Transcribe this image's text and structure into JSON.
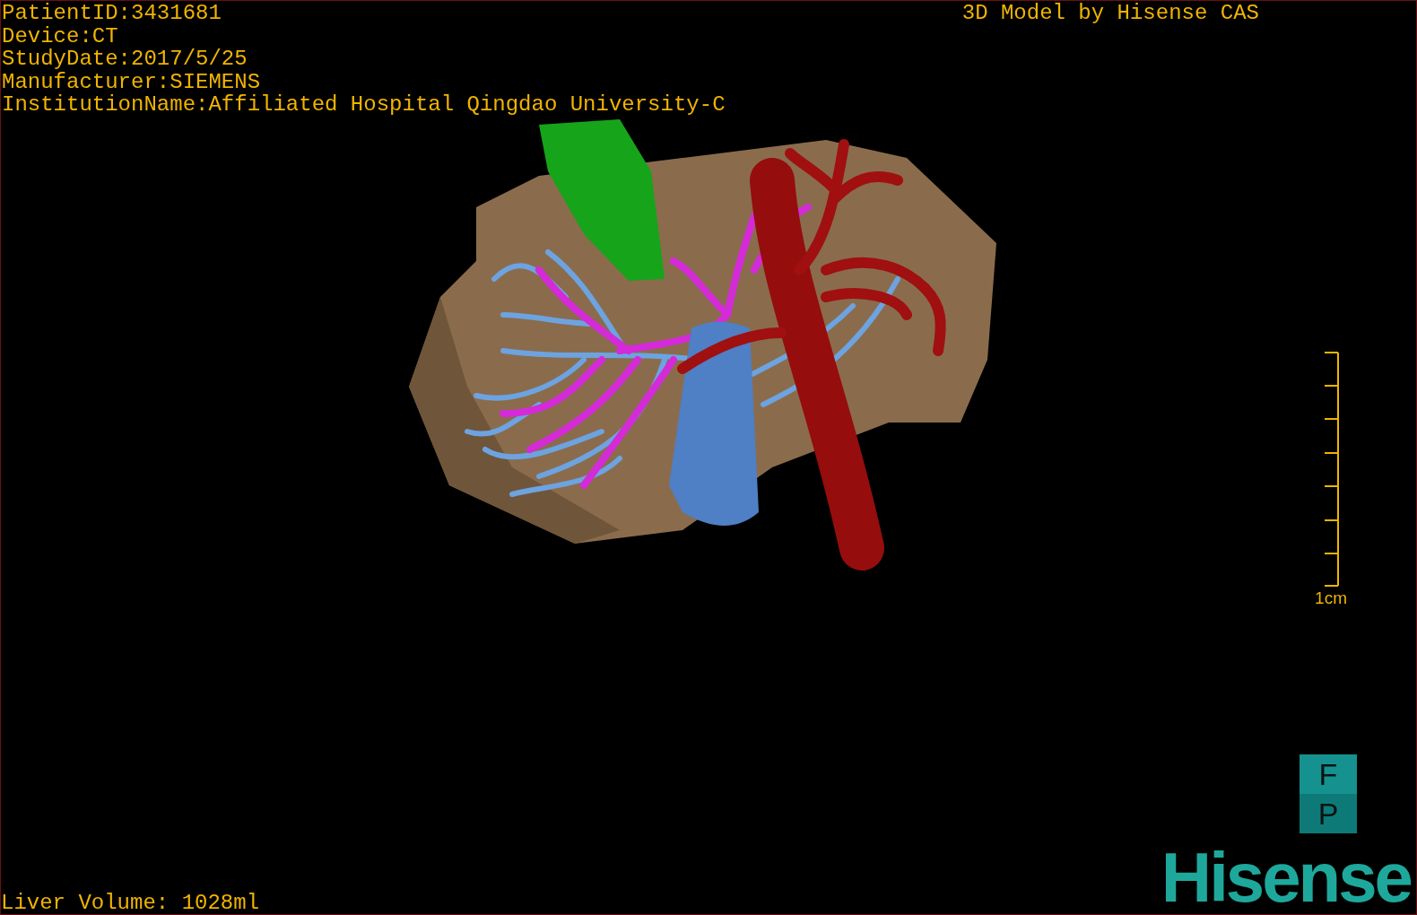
{
  "info_lines": [
    "PatientID:3431681",
    "Device:CT",
    "StudyDate:2017/5/25",
    "Manufacturer:SIEMENS",
    "InstitutionName:Affiliated Hospital Qingdao University-C"
  ],
  "title": "3D Model by Hisense CAS",
  "scale_bar": {
    "label": "1cm"
  },
  "orientation_marker": {
    "top": "F",
    "bottom": "P"
  },
  "liver_volume": "Liver Volume: 1028ml",
  "logo": "Hisense"
}
